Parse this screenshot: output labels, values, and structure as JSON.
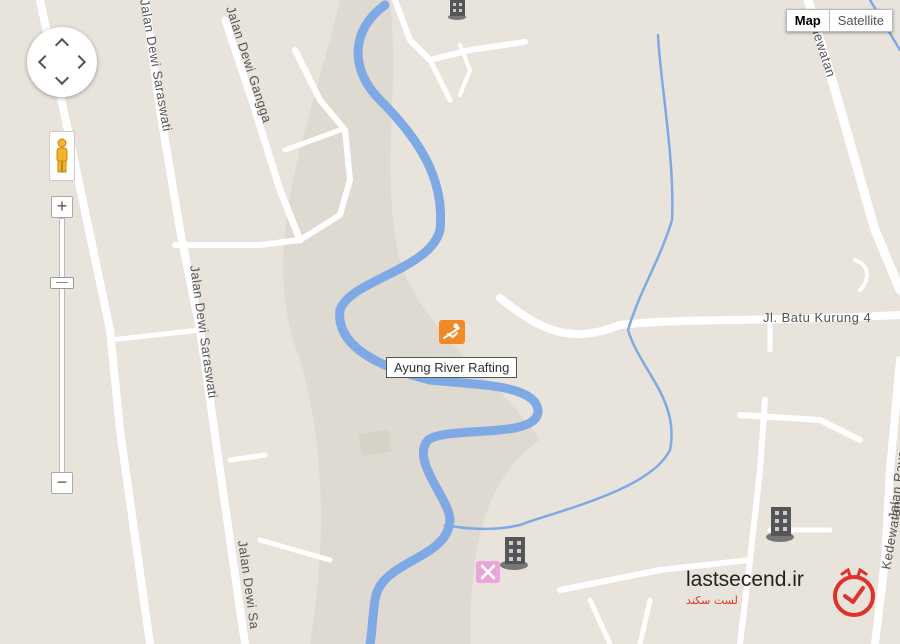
{
  "map_type": {
    "options": [
      "Map",
      "Satellite"
    ],
    "selected": "Map"
  },
  "controls": {
    "zoom_in": "+",
    "zoom_out": "−"
  },
  "roads": {
    "jalan_dewi_saraswati_1": "Jalan Dewi Saraswati",
    "jalan_dewi_saraswati_2": "Jalan Dewi Saraswati",
    "jalan_dewi_saraswati_3": "Jalan Dewi Sa",
    "jalan_dewi_gangga": "Jalan Dewi Gangga",
    "jl_batu_kurung": "Jl. Batu Kurung 4",
    "kedewatan_top": "Kedewatan",
    "kedewatan_right": "Kedewatan",
    "jalan_raya": "Jalan Raya"
  },
  "place": {
    "label": "Ayung River Rafting",
    "icon": "rafting-icon"
  },
  "icons": {
    "hotel": "hotel-icon",
    "restaurant": "restaurant-icon",
    "pegman": "pegman-icon"
  },
  "watermark": {
    "brand_main": "lastsecend.ir",
    "brand_sub": "لست سکند"
  },
  "colors": {
    "land": "#e8e4dc",
    "park": "#ddd9cf",
    "road": "#ffffff",
    "river": "#7fa9e4",
    "poi": "#f08a26",
    "accent": "#e0322b"
  }
}
